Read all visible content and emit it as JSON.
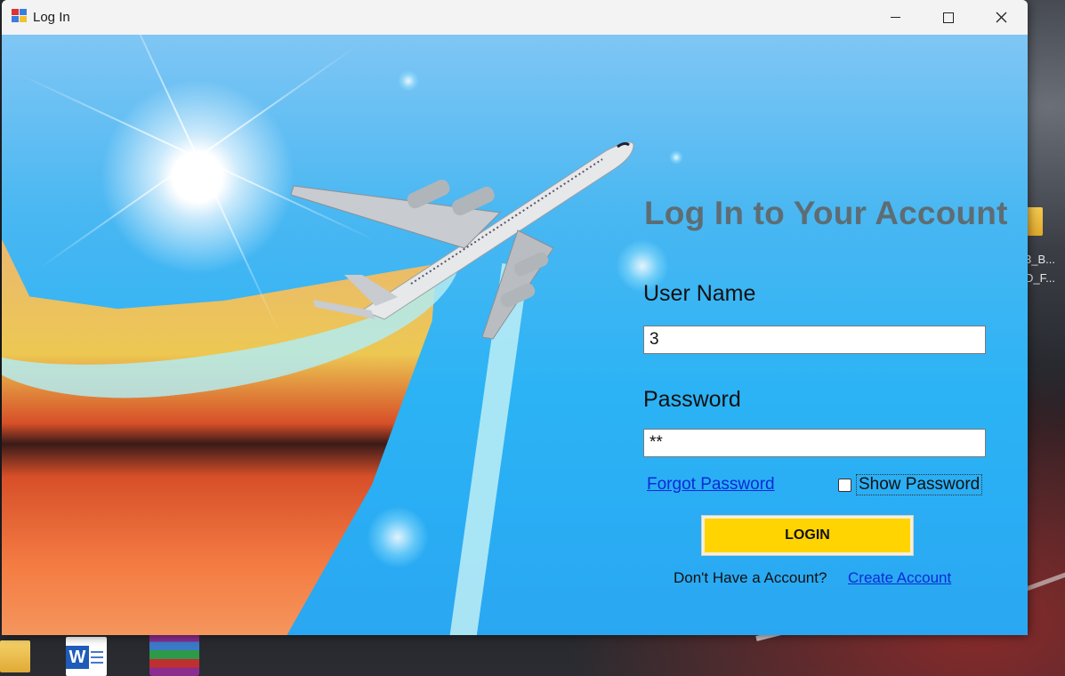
{
  "window": {
    "title": "Log In",
    "controls": {
      "minimize": "minimize-icon",
      "maximize": "maximize-icon",
      "close": "close-icon"
    }
  },
  "form": {
    "heading": "Log In to Your Account",
    "username_label": "User Name",
    "username_value": "3",
    "password_label": "Password",
    "password_value": "**",
    "forgot_password": "Forgot Password",
    "show_password_label": "Show Password",
    "show_password_checked": false,
    "login_button": "LOGIN",
    "no_account_text": "Don't Have a Account?",
    "create_account": "Create Account"
  },
  "desktop": {
    "right_labels": [
      "3_B...",
      "D_F..."
    ]
  },
  "colors": {
    "login_button": "#ffd400",
    "link": "#0a2bd6",
    "heading": "#5e6d73",
    "background_sky": "#2bb3f5"
  }
}
